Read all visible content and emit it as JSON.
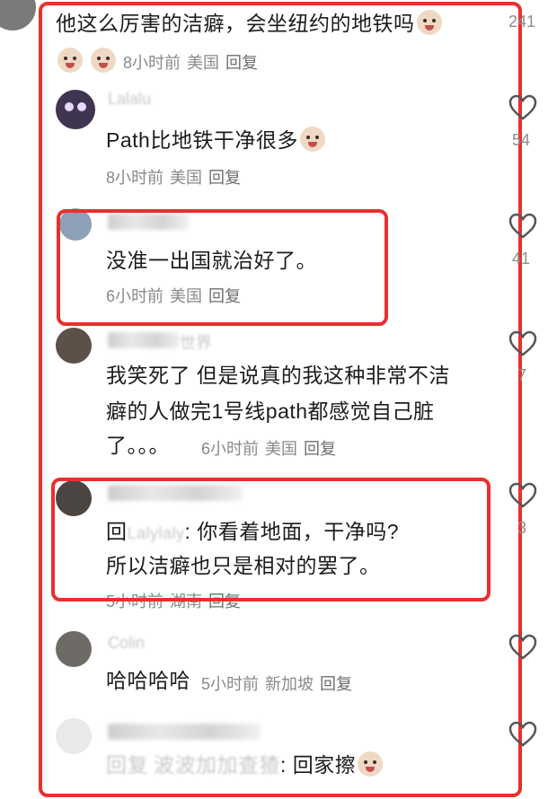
{
  "top_comment": {
    "text": "他这么厉害的洁癖，会坐纽约的地铁吗",
    "time": "8小时前",
    "location": "美国",
    "reply": "回复",
    "likes": "241"
  },
  "replies": [
    {
      "username": "Lalalu",
      "text": "Path比地铁干净很多",
      "time": "8小时前",
      "location": "美国",
      "reply": "回复",
      "likes": "54"
    },
    {
      "text": "没准一出国就治好了。",
      "time": "6小时前",
      "location": "美国",
      "reply": "回复",
      "likes": "41"
    },
    {
      "username": "世界",
      "text_line1": "我笑死了 但是说真的我这种非常不洁",
      "text_line2": "癖的人做完1号线path都感觉自己脏",
      "text_line3": "了。。。",
      "time": "6小时前",
      "location": "美国",
      "reply": "回复",
      "likes": "7"
    },
    {
      "reply_prefix": "回",
      "reply_target": "Lalylaly",
      "text_line1": ": 你看着地面，干净吗?",
      "text_line2": "所以洁癖也只是相对的罢了。",
      "time": "5小时前",
      "location": "湖南",
      "reply": "回复",
      "likes": "3"
    },
    {
      "username": "Colin",
      "text": "哈哈哈哈",
      "time": "5小时前",
      "location": "新加坡",
      "reply": "回复"
    },
    {
      "reply_prefix": "回复",
      "reply_target": "波波加加查猹",
      "text": ": 回家擦"
    }
  ],
  "colors": {
    "highlight_box": "#e8302e",
    "meta_text": "#8a8a8a"
  },
  "icons": {
    "like": "heart-outline-icon",
    "emoji": "crying-face-emoji"
  }
}
